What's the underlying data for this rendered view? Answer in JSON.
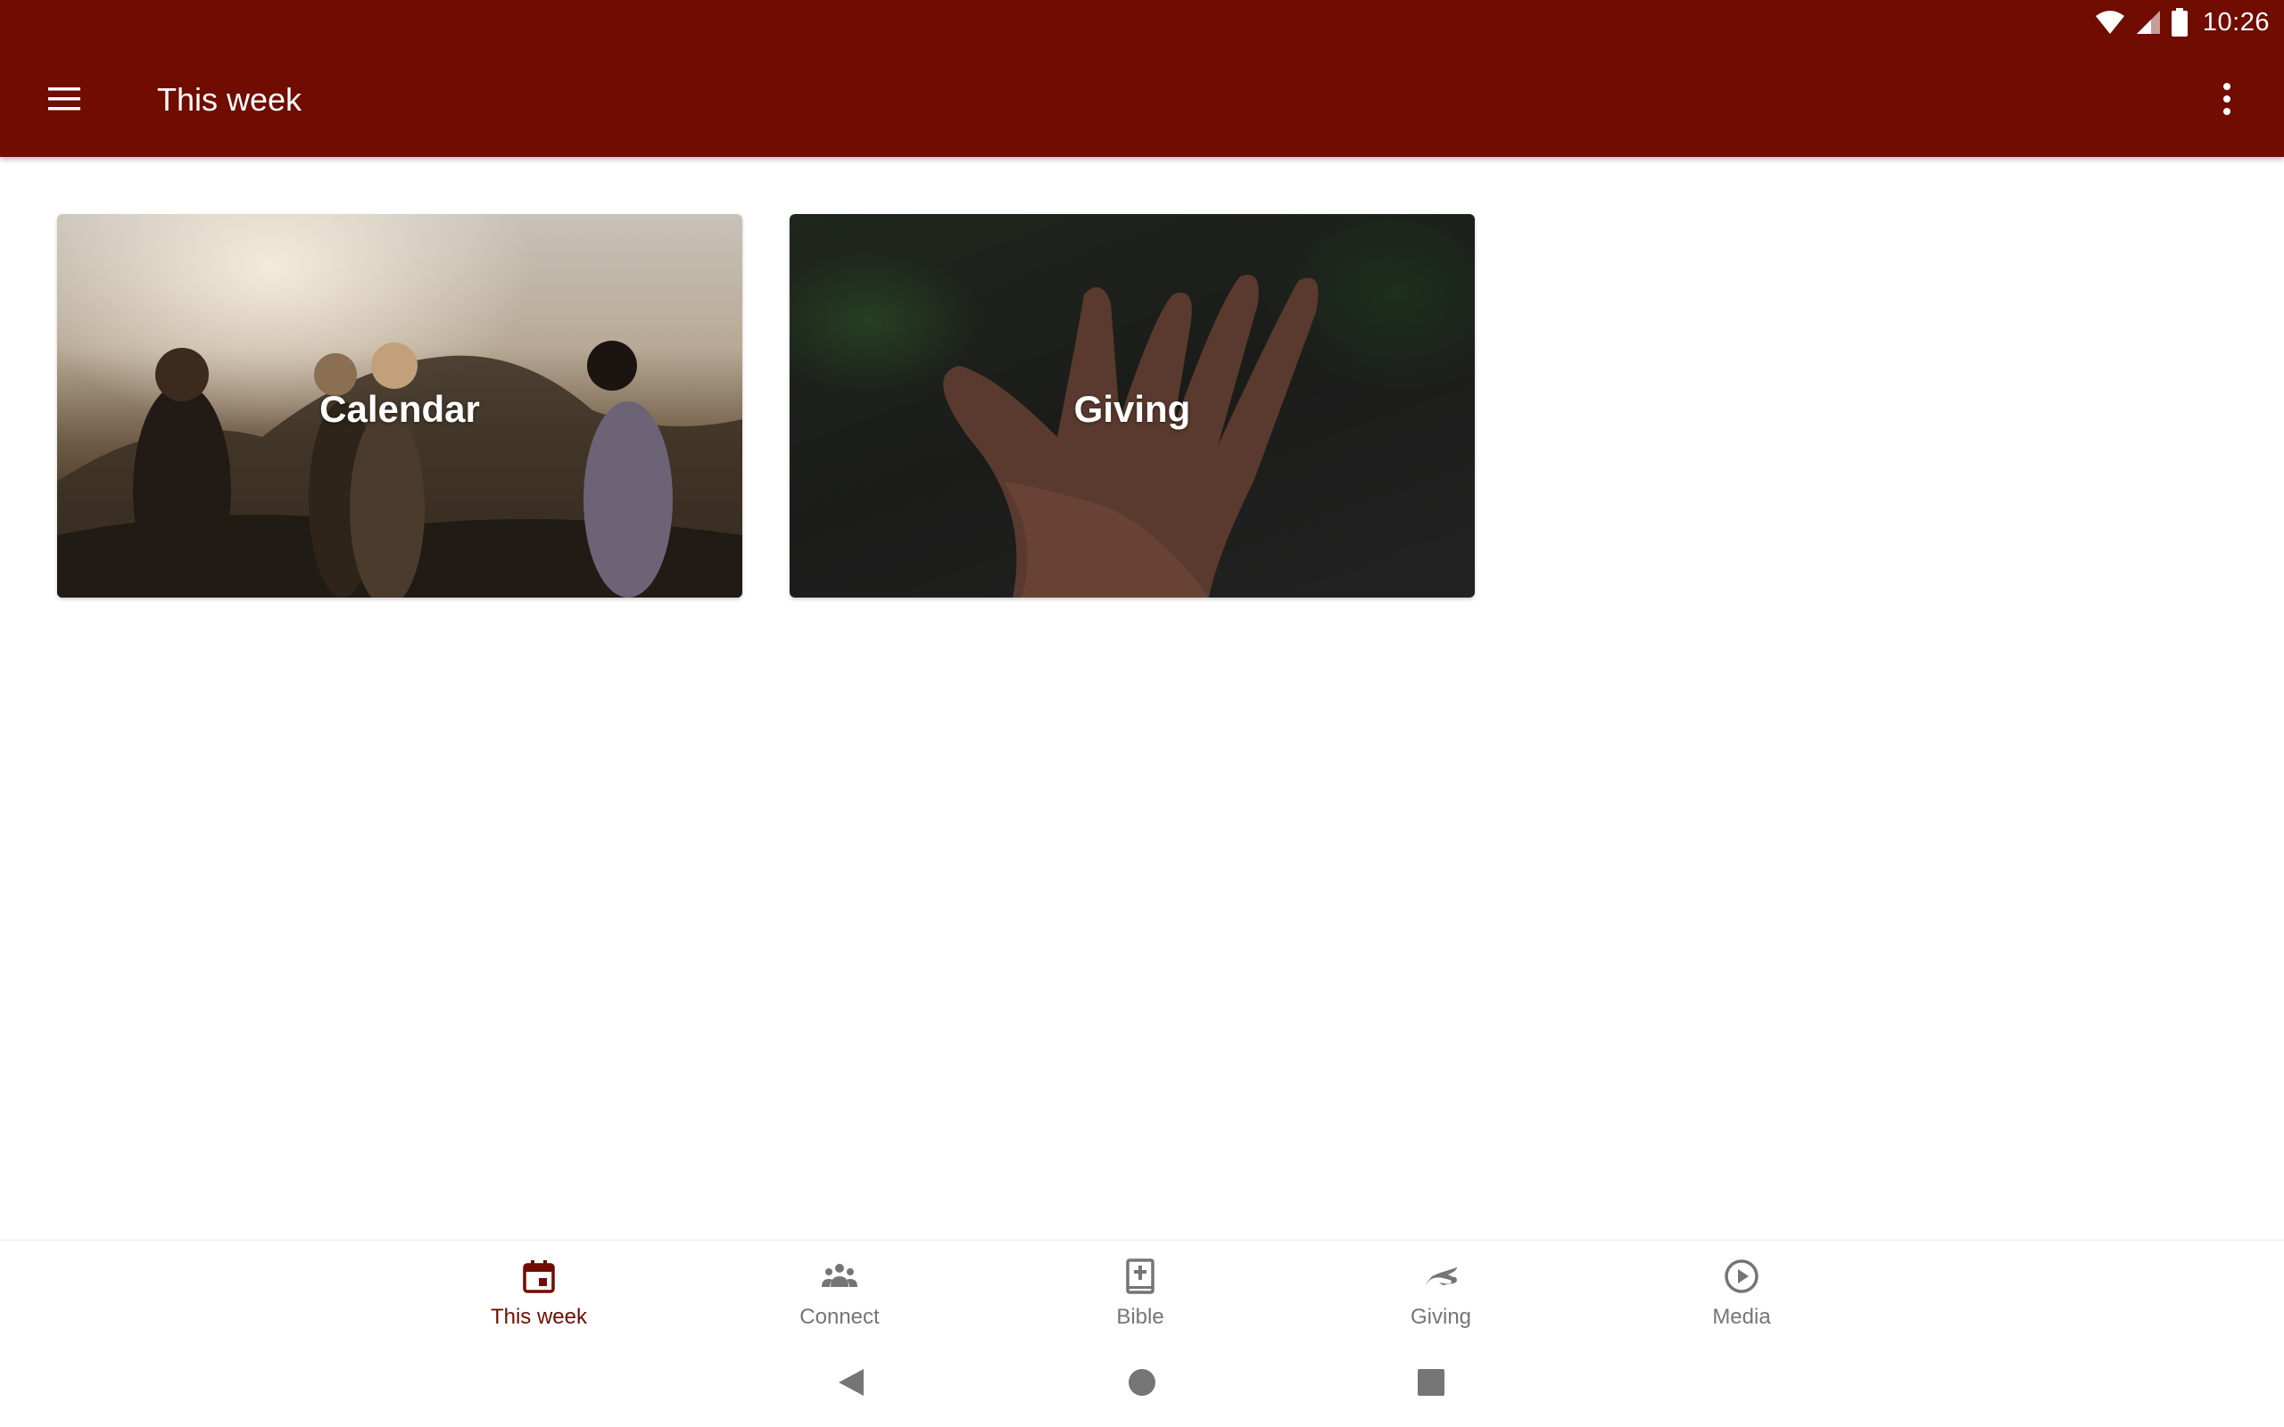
{
  "status_bar": {
    "time": "10:26",
    "icons": [
      "wifi-icon",
      "cell-signal-icon",
      "battery-icon"
    ]
  },
  "app_bar": {
    "title": "This week",
    "menu_icon": "hamburger-menu-icon",
    "overflow_icon": "more-vertical-icon",
    "background": "#700c00"
  },
  "cards": [
    {
      "label": "Calendar"
    },
    {
      "label": "Giving"
    }
  ],
  "bottom_nav": {
    "active_color": "#700c00",
    "inactive_color": "#757575",
    "items": [
      {
        "label": "This week",
        "icon": "calendar-icon",
        "active": true
      },
      {
        "label": "Connect",
        "icon": "group-icon",
        "active": false
      },
      {
        "label": "Bible",
        "icon": "book-icon",
        "active": false
      },
      {
        "label": "Giving",
        "icon": "giving-hand-icon",
        "active": false
      },
      {
        "label": "Media",
        "icon": "play-circle-icon",
        "active": false
      }
    ]
  },
  "system_nav": [
    "back-icon",
    "home-icon",
    "recents-icon"
  ]
}
